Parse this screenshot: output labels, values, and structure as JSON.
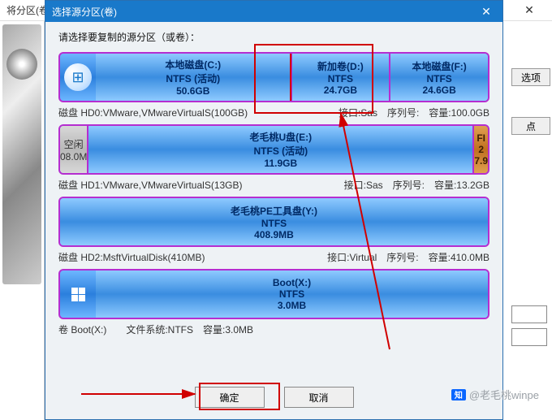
{
  "bg": {
    "title_fragment": "将分区(卷",
    "right_buttons": [
      "选项",
      "点"
    ]
  },
  "dialog": {
    "title": "选择源分区(卷)",
    "prompt": "请选择要复制的源分区（或卷）：",
    "disks": [
      {
        "os_icon": "windows-7",
        "partitions": [
          {
            "name": "本地磁盘(C:)",
            "fs": "NTFS (活动)",
            "size": "50.6GB",
            "flex": 2
          },
          {
            "name": "新加卷(D:)",
            "fs": "NTFS",
            "size": "24.7GB",
            "flex": 1,
            "selected": true
          },
          {
            "name": "本地磁盘(F:)",
            "fs": "NTFS",
            "size": "24.6GB",
            "flex": 1
          }
        ],
        "info_left": "磁盘 HD0:VMware,VMwareVirtualS(100GB)",
        "info_right": "接口:Sas　序列号:　容量:100.0GB"
      },
      {
        "os_icon": null,
        "partitions": [
          {
            "name": "空闲",
            "fs": "",
            "size": "08.0M",
            "flex": 0.25,
            "unalloc": true
          },
          {
            "name": "老毛桃U盘(E:)",
            "fs": "NTFS (活动)",
            "size": "11.9GB",
            "flex": 4
          },
          {
            "name": "FI",
            "fs": "2",
            "size": "7.9",
            "flex": 0.12,
            "smallright": true
          }
        ],
        "info_left": "磁盘 HD1:VMware,VMwareVirtualS(13GB)",
        "info_right": "接口:Sas　序列号:　容量:13.2GB"
      },
      {
        "os_icon": null,
        "partitions": [
          {
            "name": "老毛桃PE工具盘(Y:)",
            "fs": "NTFS",
            "size": "408.9MB",
            "flex": 1
          }
        ],
        "info_left": "磁盘 HD2:MsftVirtualDisk(410MB)",
        "info_right": "接口:Virtual　序列号:　容量:410.0MB"
      },
      {
        "os_icon": "windows-10",
        "partitions": [
          {
            "name": "Boot(X:)",
            "fs": "NTFS",
            "size": "3.0MB",
            "flex": 1
          }
        ],
        "info_left": "卷 Boot(X:)　　文件系统:NTFS　容量:3.0MB",
        "info_right": ""
      }
    ],
    "ok": "确定",
    "cancel": "取消"
  },
  "watermark": "@老毛桃winpe"
}
